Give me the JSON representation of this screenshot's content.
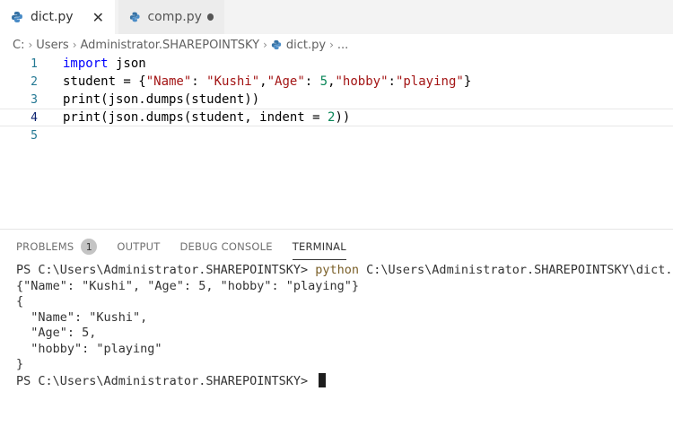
{
  "tabs": [
    {
      "label": "dict.py",
      "active": true,
      "indicator": "close-icon"
    },
    {
      "label": "comp.py",
      "active": false,
      "indicator": "dirty-dot-icon"
    }
  ],
  "breadcrumb": {
    "segments": [
      "C:",
      "Users",
      "Administrator.SHAREPOINTSKY",
      "dict.py",
      "..."
    ]
  },
  "editor": {
    "lines": [
      {
        "number": "1",
        "parts": [
          {
            "t": "import",
            "c": "kw"
          },
          {
            "t": " json",
            "c": ""
          }
        ]
      },
      {
        "number": "2",
        "parts": [
          {
            "t": "student = {",
            "c": ""
          },
          {
            "t": "\"Name\"",
            "c": "str"
          },
          {
            "t": ": ",
            "c": ""
          },
          {
            "t": "\"Kushi\"",
            "c": "str"
          },
          {
            "t": ",",
            "c": ""
          },
          {
            "t": "\"Age\"",
            "c": "str"
          },
          {
            "t": ": ",
            "c": ""
          },
          {
            "t": "5",
            "c": "num"
          },
          {
            "t": ",",
            "c": ""
          },
          {
            "t": "\"hobby\"",
            "c": "str"
          },
          {
            "t": ":",
            "c": ""
          },
          {
            "t": "\"playing\"",
            "c": "str"
          },
          {
            "t": "}",
            "c": ""
          }
        ]
      },
      {
        "number": "3",
        "parts": [
          {
            "t": "print(json.dumps(student))",
            "c": ""
          }
        ]
      },
      {
        "number": "4",
        "parts": [
          {
            "t": "print(json.dumps(student, indent = ",
            "c": ""
          },
          {
            "t": "2",
            "c": "num"
          },
          {
            "t": "))",
            "c": ""
          }
        ]
      },
      {
        "number": "5",
        "parts": []
      }
    ],
    "current_line": "4"
  },
  "panel": {
    "tabs": [
      {
        "label": "PROBLEMS",
        "badge": "1"
      },
      {
        "label": "OUTPUT"
      },
      {
        "label": "DEBUG CONSOLE"
      },
      {
        "label": "TERMINAL",
        "active": true
      }
    ]
  },
  "terminal": {
    "prompt1": "PS C:\\Users\\Administrator.SHAREPOINTSKY> ",
    "command": "python",
    "command_arg": " C:\\Users\\Administrator.SHAREPOINTSKY\\dict.py",
    "output": [
      "{\"Name\": \"Kushi\", \"Age\": 5, \"hobby\": \"playing\"}",
      "{",
      "  \"Name\": \"Kushi\",",
      "  \"Age\": 5,",
      "  \"hobby\": \"playing\"",
      "}"
    ],
    "prompt2": "PS C:\\Users\\Administrator.SHAREPOINTSKY> "
  },
  "colors": {
    "keyword": "#0000ff",
    "string": "#a31515",
    "number": "#098658",
    "line_number": "#237893",
    "command": "#795e26"
  }
}
